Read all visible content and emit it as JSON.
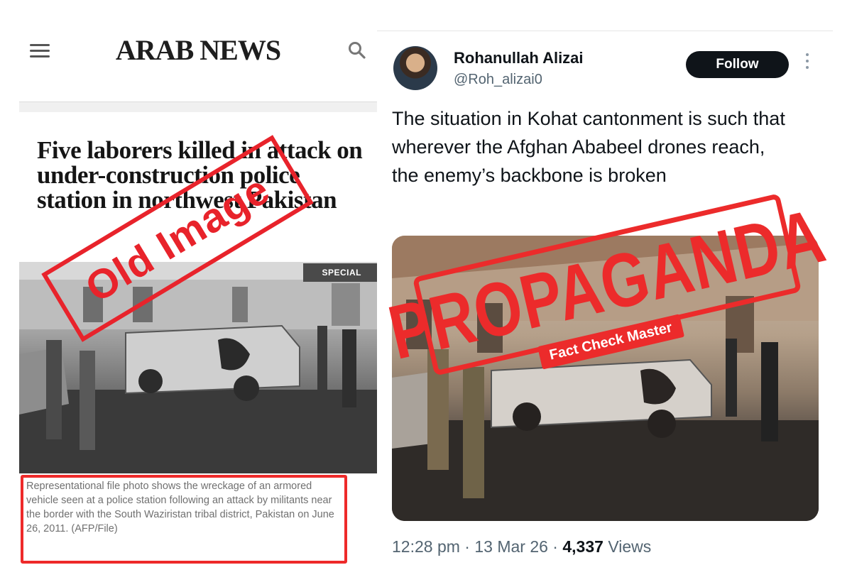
{
  "arab_news": {
    "logo": "ARAB NEWS",
    "headline": "Five laborers killed in attack on under-construction police station in northwest Pakistan",
    "badge": "SPECIAL",
    "caption": "Representational file photo shows the wreckage of an armored vehicle seen at a police station following an attack by militants near the border with the South Waziristan tribal district, Pakistan on June 26, 2011. (AFP/File)",
    "stamp": "Old Image"
  },
  "tweet": {
    "name": "Rohanullah Alizai",
    "handle": "@Roh_alizai0",
    "follow_label": "Follow",
    "text": "The situation in Kohat cantonment is such that wherever the Afghan Ababeel drones reach,\nthe enemy’s backbone is broken",
    "time": "12:28 pm",
    "date": "13 Mar 26",
    "views_count": "4,337",
    "views_label": "Views",
    "stamp": "PROPAGANDA",
    "stamp_sub": "Fact Check Master"
  },
  "colors": {
    "stamp_red": "#e8232b",
    "follow_bg": "#0f1419",
    "muted_text": "#536471"
  },
  "icons": [
    "menu-icon",
    "search-icon",
    "more-icon"
  ]
}
